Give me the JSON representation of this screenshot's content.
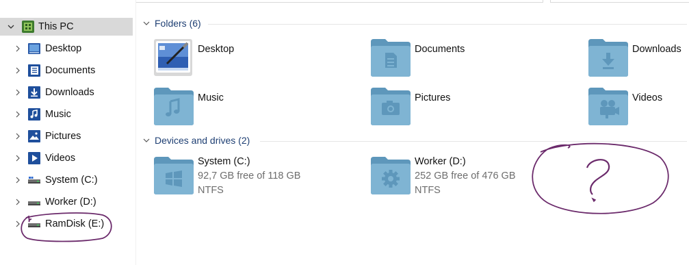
{
  "nav": {
    "items": [
      {
        "label": "This PC",
        "icon": "this-pc-icon",
        "expanded": true,
        "selected": true
      },
      {
        "label": "Desktop",
        "icon": "desktop-icon"
      },
      {
        "label": "Documents",
        "icon": "documents-icon"
      },
      {
        "label": "Downloads",
        "icon": "downloads-icon"
      },
      {
        "label": "Music",
        "icon": "music-icon"
      },
      {
        "label": "Pictures",
        "icon": "pictures-icon"
      },
      {
        "label": "Videos",
        "icon": "videos-icon"
      },
      {
        "label": "System (C:)",
        "icon": "drive-icon"
      },
      {
        "label": "Worker (D:)",
        "icon": "drive-icon"
      },
      {
        "label": "RamDisk (E:)",
        "icon": "drive-icon"
      }
    ]
  },
  "folders_group": {
    "header": "Folders (6)",
    "items": [
      {
        "name": "Desktop",
        "icon": "desktop-folder-icon"
      },
      {
        "name": "Documents",
        "icon": "documents-folder-icon"
      },
      {
        "name": "Downloads",
        "icon": "downloads-folder-icon"
      },
      {
        "name": "Music",
        "icon": "music-folder-icon"
      },
      {
        "name": "Pictures",
        "icon": "pictures-folder-icon"
      },
      {
        "name": "Videos",
        "icon": "videos-folder-icon"
      }
    ]
  },
  "drives_group": {
    "header": "Devices and drives (2)",
    "items": [
      {
        "name": "System (C:)",
        "free": "92,7 GB free of 118 GB",
        "fs": "NTFS",
        "icon": "windows-drive-icon"
      },
      {
        "name": "Worker (D:)",
        "free": "252 GB free of 476 GB",
        "fs": "NTFS",
        "icon": "gear-drive-icon"
      }
    ]
  },
  "annotation": {
    "question_mark": "?",
    "color": "#6b2a6b"
  },
  "colors": {
    "folder_blue": "#7fb4d3",
    "folder_dark": "#5e97bb",
    "selected_bg": "#d9d9d9",
    "header_text": "#1e3f73"
  }
}
